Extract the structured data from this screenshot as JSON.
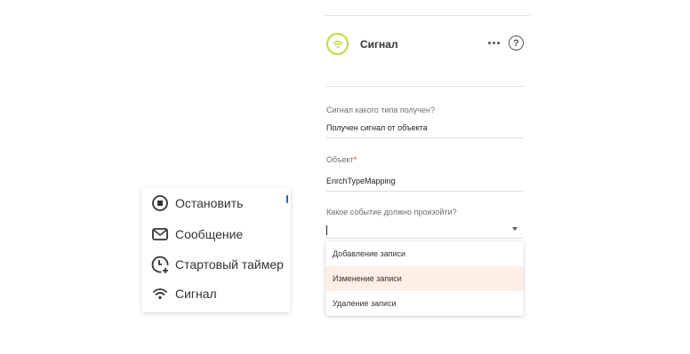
{
  "palette": {
    "items": [
      {
        "label": "Остановить",
        "icon": "stop-icon"
      },
      {
        "label": "Сообщение",
        "icon": "envelope-icon"
      },
      {
        "label": "Стартовый таймер",
        "icon": "timer-plus-icon"
      },
      {
        "label": "Сигнал",
        "icon": "wifi-signal-icon"
      }
    ]
  },
  "panel": {
    "header": {
      "title": "Сигнал",
      "icon": "wifi-signal-icon",
      "accent_color": "#c3d93b",
      "help_glyph": "?"
    },
    "signal_type": {
      "label": "Сигнал какого типа получен?",
      "value": "Получен сигнал от объекта"
    },
    "object": {
      "label": "Объект",
      "required_mark": "*",
      "value": "EnrchTypeMapping"
    },
    "event": {
      "label": "Какое событие должно произойти?",
      "value": "",
      "options": [
        "Добавление записи",
        "Изменение записи",
        "Удаление записи"
      ],
      "highlighted_option": "Изменение записи",
      "highlight_color": "#fdeee6"
    }
  }
}
